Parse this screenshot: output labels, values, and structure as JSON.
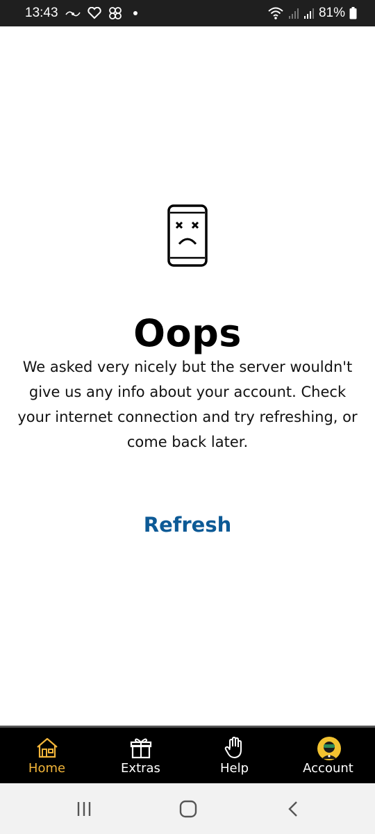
{
  "status_bar": {
    "time": "13:43",
    "battery": "81%"
  },
  "error": {
    "title": "Oops",
    "message": "We asked very nicely but the server wouldn't give us any info about your account. Check your internet connection and try refreshing, or come back later.",
    "refresh_label": "Refresh",
    "icon": "sad-phone-icon"
  },
  "bottom_nav": {
    "items": [
      {
        "label": "Home",
        "icon": "home-icon",
        "active": true
      },
      {
        "label": "Extras",
        "icon": "gift-icon",
        "active": false
      },
      {
        "label": "Help",
        "icon": "hand-icon",
        "active": false
      },
      {
        "label": "Account",
        "icon": "avatar-icon",
        "active": false
      }
    ]
  },
  "system_nav": {
    "buttons": [
      "recent-apps-icon",
      "home-button-icon",
      "back-icon"
    ]
  },
  "colors": {
    "accent": "#f2b53a",
    "link": "#0d5a96",
    "nav_background": "#000000",
    "status_bar_background": "#1f1f1f"
  }
}
